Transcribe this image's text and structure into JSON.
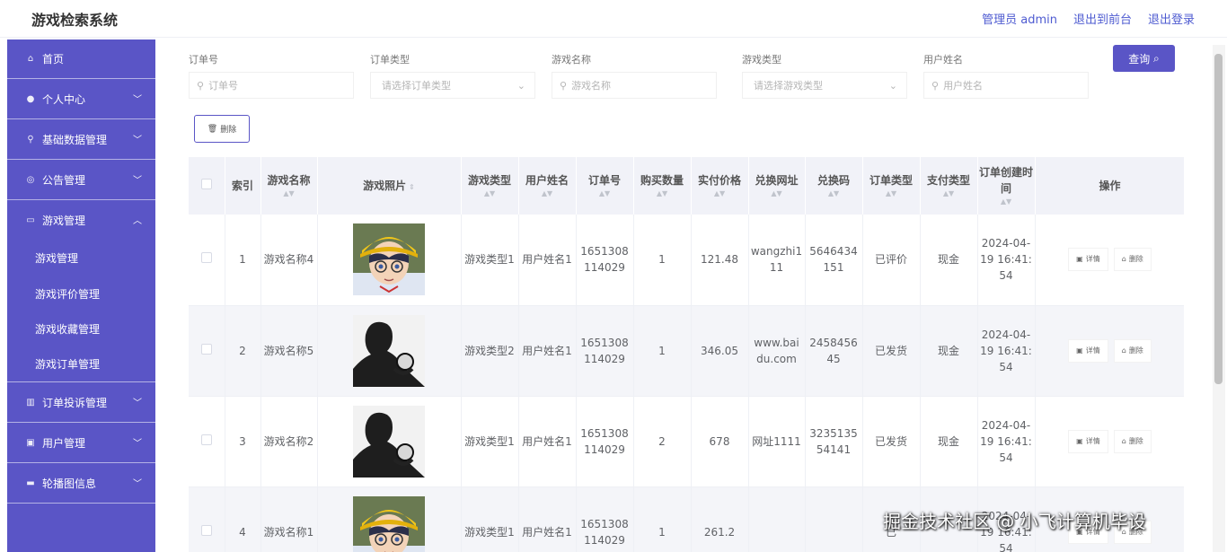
{
  "header": {
    "title": "游戏检索系统",
    "admin_label": "管理员 admin",
    "frontend_link": "退出到前台",
    "logout_link": "退出登录"
  },
  "sidebar": {
    "home": "首页",
    "items": [
      {
        "label": "个人中心",
        "icon": "user-icon",
        "expanded": false
      },
      {
        "label": "基础数据管理",
        "icon": "pin-icon",
        "expanded": false
      },
      {
        "label": "公告管理",
        "icon": "notice-icon",
        "expanded": false
      },
      {
        "label": "游戏管理",
        "icon": "game-icon",
        "expanded": true
      },
      {
        "label": "订单投诉管理",
        "icon": "chart-icon",
        "expanded": false
      },
      {
        "label": "用户管理",
        "icon": "user-manage-icon",
        "expanded": false
      },
      {
        "label": "轮播图信息",
        "icon": "carousel-icon",
        "expanded": false
      }
    ],
    "sub_items": [
      "游戏管理",
      "游戏评价管理",
      "游戏收藏管理",
      "游戏订单管理"
    ]
  },
  "search": {
    "fields": [
      {
        "label": "订单号",
        "placeholder": "订单号",
        "type": "input"
      },
      {
        "label": "订单类型",
        "placeholder": "请选择订单类型",
        "type": "select"
      },
      {
        "label": "游戏名称",
        "placeholder": "游戏名称",
        "type": "input"
      },
      {
        "label": "游戏类型",
        "placeholder": "请选择游戏类型",
        "type": "select"
      },
      {
        "label": "用户姓名",
        "placeholder": "用户姓名",
        "type": "input"
      }
    ],
    "query_button": "查询",
    "delete_button": "删除"
  },
  "table": {
    "columns": [
      "索引",
      "游戏名称",
      "游戏照片",
      "游戏类型",
      "用户姓名",
      "订单号",
      "购买数量",
      "实付价格",
      "兑换网址",
      "兑换码",
      "订单类型",
      "支付类型",
      "订单创建时间",
      "操作"
    ],
    "rows": [
      {
        "index": "1",
        "name": "游戏名称4",
        "photo": "anime-boy",
        "type": "游戏类型1",
        "user": "用户姓名1",
        "order_no": "1651308114029",
        "qty": "1",
        "price": "121.48",
        "url": "wangzhi111",
        "code": "5646434151",
        "order_type": "已评价",
        "pay_type": "现金",
        "created": "2024-04-19 16:41:54"
      },
      {
        "index": "2",
        "name": "游戏名称5",
        "photo": "silhouette",
        "type": "游戏类型2",
        "user": "用户姓名1",
        "order_no": "1651308114029",
        "qty": "1",
        "price": "346.05",
        "url": "www.baidu.com",
        "code": "245845645",
        "order_type": "已发货",
        "pay_type": "现金",
        "created": "2024-04-19 16:41:54"
      },
      {
        "index": "3",
        "name": "游戏名称2",
        "photo": "silhouette",
        "type": "游戏类型1",
        "user": "用户姓名1",
        "order_no": "1651308114029",
        "qty": "2",
        "price": "678",
        "url": "网址1111",
        "code": "323513554141",
        "order_type": "已发货",
        "pay_type": "现金",
        "created": "2024-04-19 16:41:54"
      },
      {
        "index": "4",
        "name": "游戏名称1",
        "photo": "anime-boy",
        "type": "游戏类型1",
        "user": "用户姓名1",
        "order_no": "1651308114029",
        "qty": "1",
        "price": "261.2",
        "url": "",
        "code": "",
        "order_type": "已",
        "pay_type": "",
        "created": "2024-04-19 16:41:54"
      }
    ],
    "detail_label": "详情",
    "delete_label": "删除"
  },
  "watermark": "掘金技术社区 @ 小飞计算机毕设"
}
